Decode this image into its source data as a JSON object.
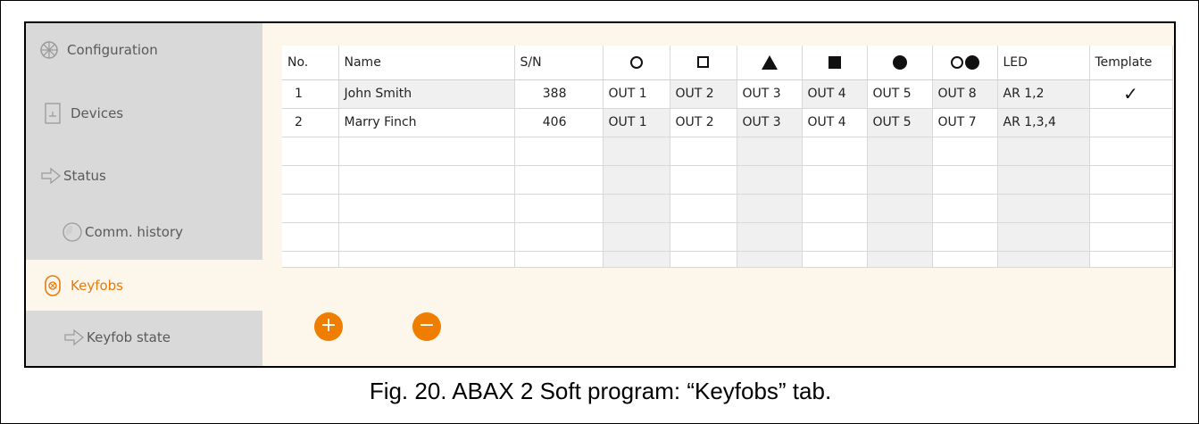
{
  "sidebar": {
    "items": [
      {
        "label": "Configuration",
        "icon": "configuration-icon"
      },
      {
        "label": "Devices",
        "icon": "devices-icon"
      },
      {
        "label": "Status",
        "icon": "status-icon"
      },
      {
        "label": "Comm. history",
        "icon": "comm-history-icon"
      },
      {
        "label": "Keyfobs",
        "icon": "keyfob-icon",
        "active": true
      },
      {
        "label": "Keyfob state",
        "icon": "keyfob-state-icon"
      }
    ]
  },
  "table": {
    "headers": {
      "no": "No.",
      "name": "Name",
      "sn": "S/N",
      "led": "LED",
      "template": "Template"
    },
    "button_icons": [
      "circle-outline-icon",
      "square-outline-icon",
      "triangle-icon",
      "square-filled-icon",
      "circle-filled-icon",
      "two-circles-icon"
    ],
    "rows": [
      {
        "no": "1",
        "name": "John Smith",
        "sn": "388",
        "o1": "OUT 1",
        "o2": "OUT 2",
        "o3": "OUT 3",
        "o4": "OUT 4",
        "o5": "OUT 5",
        "o6": "OUT 8",
        "led": "AR 1,2",
        "template": "✓"
      },
      {
        "no": "2",
        "name": "Marry Finch",
        "sn": "406",
        "o1": "OUT 1",
        "o2": "OUT 2",
        "o3": "OUT 3",
        "o4": "OUT 4",
        "o5": "OUT 5",
        "o6": "OUT 7",
        "led": "AR 1,3,4",
        "template": ""
      }
    ]
  },
  "buttons": {
    "add": "+",
    "remove": "−"
  },
  "caption": "Fig. 20. ABAX 2 Soft program: “Keyfobs” tab.",
  "colors": {
    "accent": "#ef7d00",
    "sidebar_bg": "#d9d9d9",
    "panel_bg": "#fdf6ea"
  }
}
